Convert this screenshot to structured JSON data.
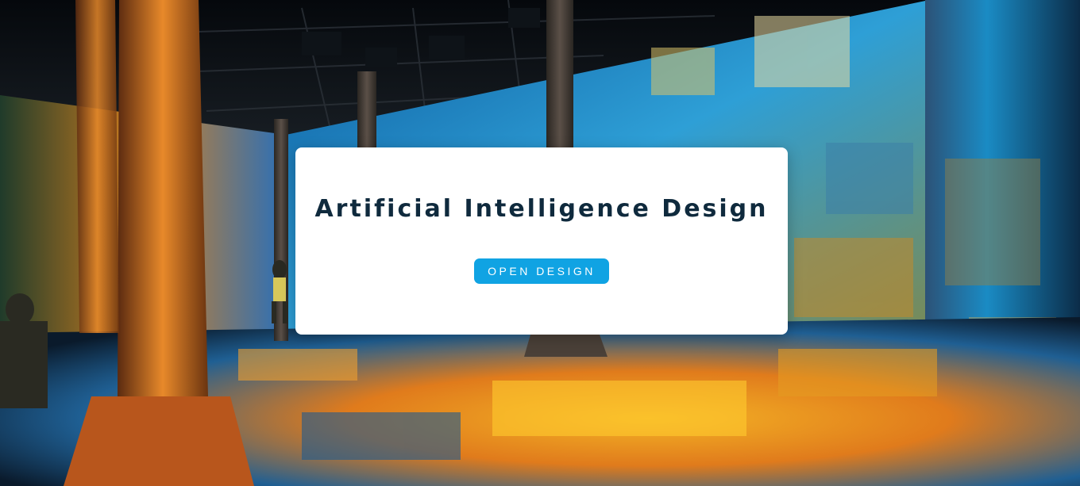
{
  "hero": {
    "title": "Artificial Intelligence Design",
    "cta_label": "OPEN DESIGN",
    "background_image": "immersive-art-exhibition-photo",
    "colors": {
      "cta_background": "#10a3e3",
      "title": "#0f2a3d",
      "card_background": "#ffffff"
    }
  }
}
